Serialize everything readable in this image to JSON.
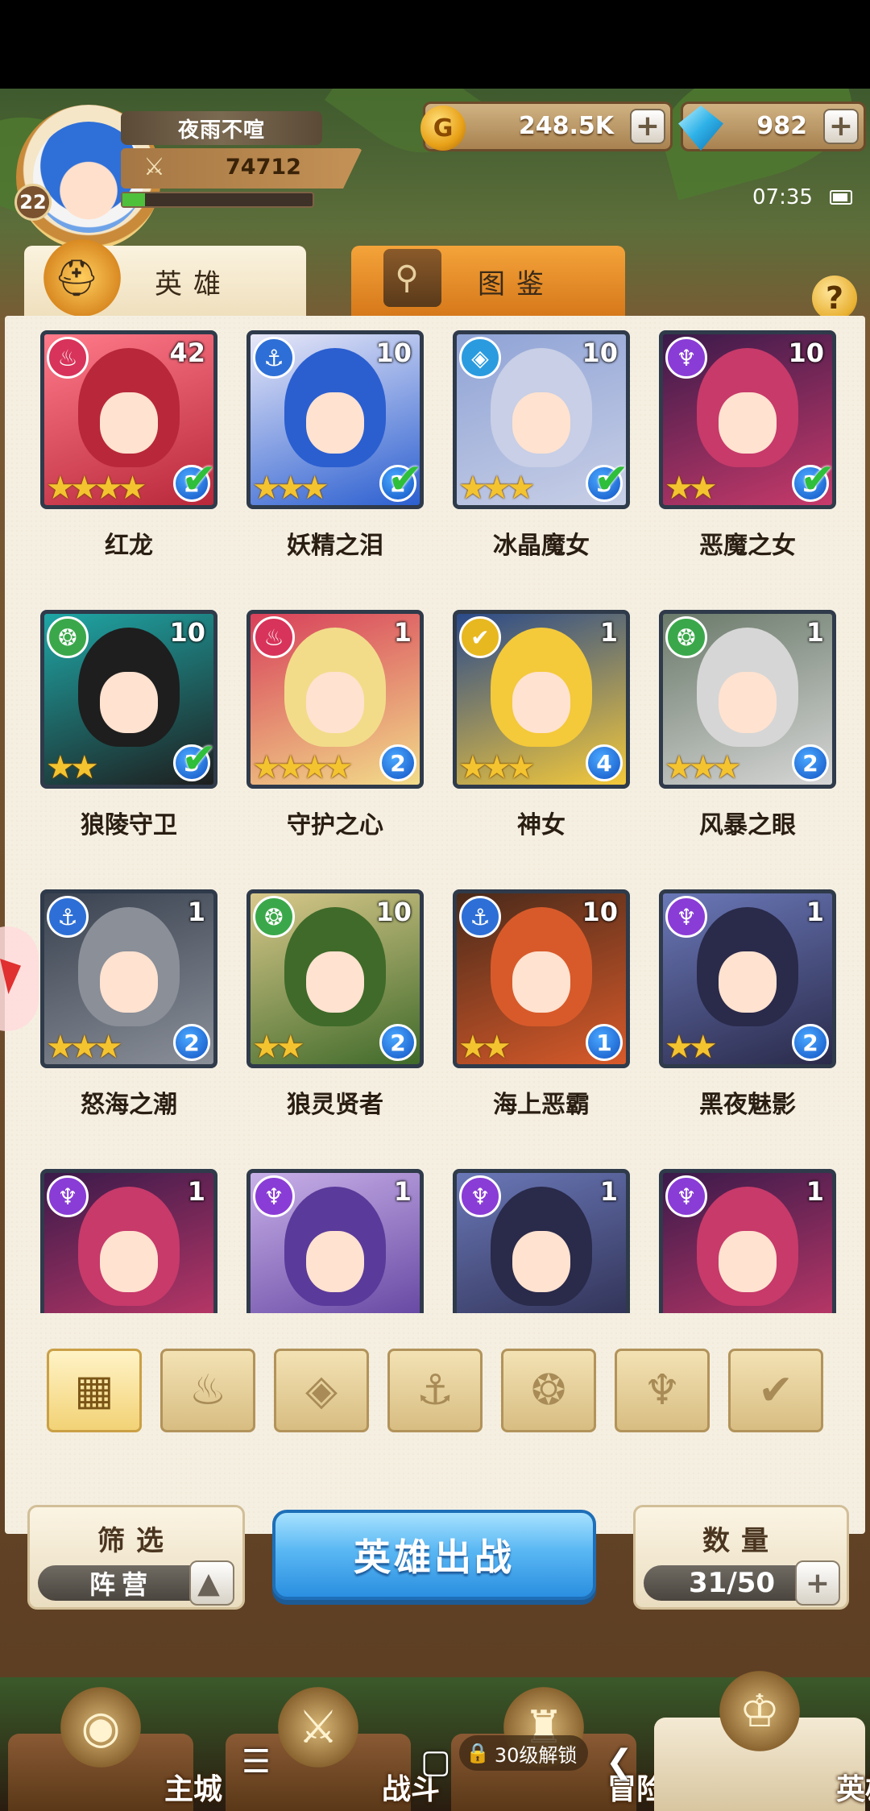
{
  "player": {
    "name": "夜雨不喧",
    "level": "22",
    "power": "74712",
    "xp_fraction": 0.12
  },
  "resources": {
    "gold": "248.5K",
    "gems": "982",
    "plus": "+"
  },
  "status": {
    "time": "07:35"
  },
  "tabs": {
    "heroes": "英雄",
    "codex": "图鉴"
  },
  "help_label": "?",
  "heroes": [
    {
      "name": "红龙",
      "level": "42",
      "stars": 4,
      "rank": "2",
      "deployed": true,
      "faction": "fire",
      "faction_color": "#d8335a",
      "palette": [
        "#b8283a",
        "#ff7a8a"
      ]
    },
    {
      "name": "妖精之泪",
      "level": "10",
      "stars": 3,
      "rank": "2",
      "deployed": true,
      "faction": "anchor",
      "faction_color": "#2d6fd6",
      "palette": [
        "#2b5fd0",
        "#e8e8f8"
      ]
    },
    {
      "name": "冰晶魔女",
      "level": "10",
      "stars": 3,
      "rank": "3",
      "deployed": true,
      "faction": "diamond",
      "faction_color": "#2b9be0",
      "palette": [
        "#c8cfe6",
        "#8fa3d6"
      ]
    },
    {
      "name": "恶魔之女",
      "level": "10",
      "stars": 2,
      "rank": "3",
      "deployed": true,
      "faction": "demon",
      "faction_color": "#8a3cd6",
      "palette": [
        "#c73a6a",
        "#3a1a4a"
      ]
    },
    {
      "name": "狼陵守卫",
      "level": "10",
      "stars": 2,
      "rank": "3",
      "deployed": true,
      "faction": "beast",
      "faction_color": "#3aa84a",
      "palette": [
        "#1e1e1e",
        "#1fa6a6"
      ]
    },
    {
      "name": "守护之心",
      "level": "1",
      "stars": 4,
      "rank": "2",
      "deployed": false,
      "faction": "fire",
      "faction_color": "#d8335a",
      "palette": [
        "#f2dc8a",
        "#d8405a"
      ]
    },
    {
      "name": "神女",
      "level": "1",
      "stars": 3,
      "rank": "4",
      "deployed": false,
      "faction": "light",
      "faction_color": "#e8b820",
      "palette": [
        "#f4c93a",
        "#2a4a8a"
      ]
    },
    {
      "name": "风暴之眼",
      "level": "1",
      "stars": 3,
      "rank": "2",
      "deployed": false,
      "faction": "beast",
      "faction_color": "#3aa84a",
      "palette": [
        "#d6d6d6",
        "#6a7a6a"
      ]
    },
    {
      "name": "怒海之潮",
      "level": "1",
      "stars": 3,
      "rank": "2",
      "deployed": false,
      "faction": "anchor",
      "faction_color": "#2d6fd6",
      "palette": [
        "#8a8f98",
        "#3a4250"
      ]
    },
    {
      "name": "狼灵贤者",
      "level": "10",
      "stars": 2,
      "rank": "2",
      "deployed": false,
      "faction": "beast",
      "faction_color": "#3aa84a",
      "palette": [
        "#3f6a2a",
        "#d8c88a"
      ]
    },
    {
      "name": "海上恶霸",
      "level": "10",
      "stars": 2,
      "rank": "1",
      "deployed": false,
      "faction": "anchor",
      "faction_color": "#2d6fd6",
      "palette": [
        "#d85a2a",
        "#4a2a1a"
      ]
    },
    {
      "name": "黑夜魅影",
      "level": "1",
      "stars": 2,
      "rank": "2",
      "deployed": false,
      "faction": "demon",
      "faction_color": "#8a3cd6",
      "palette": [
        "#2a2a4a",
        "#6a78b8"
      ]
    },
    {
      "name": "",
      "level": "1",
      "stars": 0,
      "rank": "",
      "deployed": false,
      "faction": "demon",
      "faction_color": "#8a3cd6",
      "palette": [
        "#c73a6a",
        "#3a1a4a"
      ]
    },
    {
      "name": "",
      "level": "1",
      "stars": 0,
      "rank": "",
      "deployed": false,
      "faction": "demon",
      "faction_color": "#8a3cd6",
      "palette": [
        "#5a3a9a",
        "#c8b0e8"
      ]
    },
    {
      "name": "",
      "level": "1",
      "stars": 0,
      "rank": "",
      "deployed": false,
      "faction": "demon",
      "faction_color": "#8a3cd6",
      "palette": [
        "#2a2a4a",
        "#6a78b8"
      ]
    },
    {
      "name": "",
      "level": "1",
      "stars": 0,
      "rank": "",
      "deployed": false,
      "faction": "demon",
      "faction_color": "#8a3cd6",
      "palette": [
        "#c73a6a",
        "#3a1a4a"
      ]
    }
  ],
  "faction_filters": [
    {
      "icon": "all-grid-icon",
      "glyph": "▦",
      "active": true
    },
    {
      "icon": "fire-faction-icon",
      "glyph": "♨",
      "active": false
    },
    {
      "icon": "diamond-faction-icon",
      "glyph": "◈",
      "active": false
    },
    {
      "icon": "anchor-faction-icon",
      "glyph": "⚓",
      "active": false
    },
    {
      "icon": "beast-faction-icon",
      "glyph": "❂",
      "active": false
    },
    {
      "icon": "demon-faction-icon",
      "glyph": "♆",
      "active": false
    },
    {
      "icon": "light-faction-icon",
      "glyph": "✔",
      "active": false
    }
  ],
  "controls": {
    "filter_title": "筛选",
    "filter_value": "阵营",
    "deploy_label": "英雄出战",
    "count_title": "数量",
    "count_value": "31/50"
  },
  "nav": {
    "city": "主城",
    "battle": "战斗",
    "adventure": "冒险",
    "hero": "英雄",
    "lock_text": "30级解锁"
  }
}
